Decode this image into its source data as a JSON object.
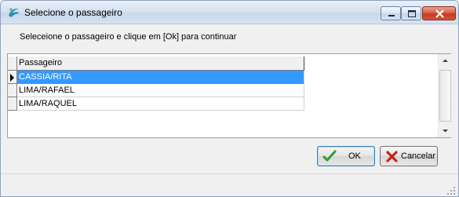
{
  "window": {
    "title": "Selecione o passageiro"
  },
  "header": {
    "instruction": "Seleceione o passageiro e clique em [Ok] para continuar"
  },
  "grid": {
    "columns": [
      "Passageiro"
    ],
    "rows": [
      {
        "passageiro": "CASSIA/RITA",
        "selected": true
      },
      {
        "passageiro": "LIMA/RAFAEL",
        "selected": false
      },
      {
        "passageiro": "LIMA/RAQUEL",
        "selected": false
      }
    ]
  },
  "buttons": {
    "ok_label": "OK",
    "cancel_label": "Cancelar"
  },
  "icons": {
    "app": "app-swirl-icon",
    "ok": "checkmark-icon",
    "cancel": "x-mark-icon"
  },
  "colors": {
    "selection": "#3399ff",
    "ok_check": "#2e9e2e",
    "cancel_x": "#c0281c"
  }
}
